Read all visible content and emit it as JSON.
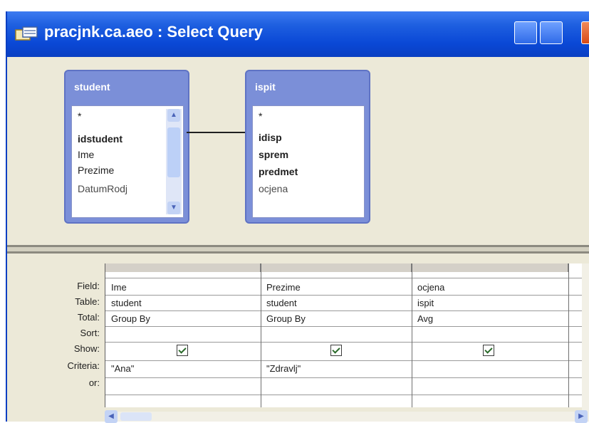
{
  "window": {
    "title": "pracjnk.ca.aeo : Select Query",
    "buttons": [
      "minimize",
      "maximize",
      "close"
    ]
  },
  "tables": [
    {
      "name": "student",
      "fields": [
        "*",
        "idstudent",
        "Ime",
        "Prezime",
        "DatumRodj"
      ]
    },
    {
      "name": "ispit",
      "fields": [
        "*",
        "idisp",
        "sprem",
        "predmet",
        "ocjena"
      ]
    }
  ],
  "grid": {
    "row_labels": [
      "Field:",
      "Table:",
      "Total:",
      "Sort:",
      "Show:",
      "Criteria:",
      "or:"
    ],
    "columns": [
      {
        "field": "Ime",
        "table": "student",
        "total": "Group By",
        "sort": "",
        "show": true,
        "criteria": "\"Ana\"",
        "or": ""
      },
      {
        "field": "Prezime",
        "table": "student",
        "total": "Group By",
        "sort": "",
        "show": true,
        "criteria": "\"Zdravlj\"",
        "or": ""
      },
      {
        "field": "ocjena",
        "table": "ispit",
        "total": "Avg",
        "sort": "",
        "show": true,
        "criteria": "",
        "or": ""
      }
    ]
  },
  "icons": {
    "app": "query-icon",
    "scroll_up": "scroll-up-arrow-icon",
    "scroll_down": "scroll-down-arrow-icon",
    "scroll_left": "scroll-left-arrow-icon",
    "scroll_right": "scroll-right-arrow-icon"
  },
  "colors": {
    "titlebar": "#0a48d6",
    "table_header": "#7b8fd8",
    "window_bg": "#ece9d8"
  }
}
